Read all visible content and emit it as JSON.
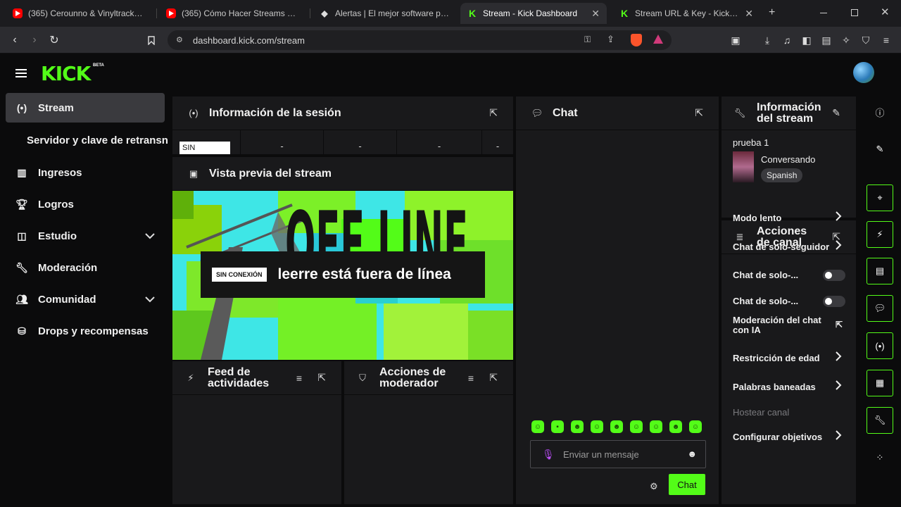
{
  "browser": {
    "tabs": [
      {
        "title": "(365) Cerounno & Vinyltracker - JC",
        "favicon": "youtube-icon"
      },
      {
        "title": "(365) Cómo Hacer Streams en Kick",
        "favicon": "youtube-icon"
      },
      {
        "title": "Alertas | El mejor software para po",
        "favicon": "diamond-icon"
      },
      {
        "title": "Stream - Kick Dashboard",
        "favicon": "kick-icon",
        "close": "✕"
      },
      {
        "title": "Stream URL & Key - Kick Dashboa",
        "favicon": "kick-icon",
        "close": "✕"
      }
    ],
    "new_tab": "+",
    "url": "dashboard.kick.com/stream"
  },
  "header": {
    "logo": "KICK",
    "logo_badge": "BETA"
  },
  "sidebar": {
    "items": [
      {
        "label": "Stream",
        "icon": "broadcast-icon"
      },
      {
        "label": "Servidor y clave de retransn"
      },
      {
        "label": "Ingresos",
        "icon": "chart-icon"
      },
      {
        "label": "Logros",
        "icon": "trophy-icon"
      },
      {
        "label": "Estudio",
        "icon": "studio-icon"
      },
      {
        "label": "Moderación",
        "icon": "wrench-icon"
      },
      {
        "label": "Comunidad",
        "icon": "users-icon"
      },
      {
        "label": "Drops y recompensas",
        "icon": "drops-icon"
      }
    ]
  },
  "session": {
    "title": "Información de la sesión",
    "badge": "SIN",
    "stats": [
      "-",
      "-",
      "-",
      "-"
    ]
  },
  "preview": {
    "title": "Vista previa del stream",
    "badge": "SIN CONEXIÓN",
    "offline_text": "leerre está fuera de línea",
    "bg_text": "OFF LINE"
  },
  "activity": {
    "title": "Feed de actividades"
  },
  "modactions": {
    "title": "Acciones de moderador"
  },
  "chat": {
    "title": "Chat",
    "placeholder": "Enviar un mensaje",
    "send_label": "Chat",
    "emote_count": 9
  },
  "stream_info": {
    "title": "Información del stream",
    "stream_title": "prueba 1",
    "category": "Conversando",
    "language": "Spanish"
  },
  "channel_actions": {
    "title": "Acciones de canal",
    "items": [
      {
        "label": "Modo lento",
        "control": "chevron"
      },
      {
        "label": "Chat de solo-seguidor",
        "control": "chevron"
      },
      {
        "label": "Chat de solo-...",
        "control": "toggle"
      },
      {
        "label": "Chat de solo-...",
        "control": "toggle"
      },
      {
        "label": "Moderación del chat con IA",
        "control": "external"
      },
      {
        "label": "Restricción de edad",
        "control": "chevron"
      },
      {
        "label": "Palabras baneadas",
        "control": "chevron"
      },
      {
        "label": "Hostear canal",
        "control": "none"
      },
      {
        "label": "Configurar objetivos",
        "control": "chevron"
      }
    ]
  },
  "colors": {
    "accent": "#53fc18",
    "panel": "#19191b",
    "background": "#0b0b0c"
  }
}
